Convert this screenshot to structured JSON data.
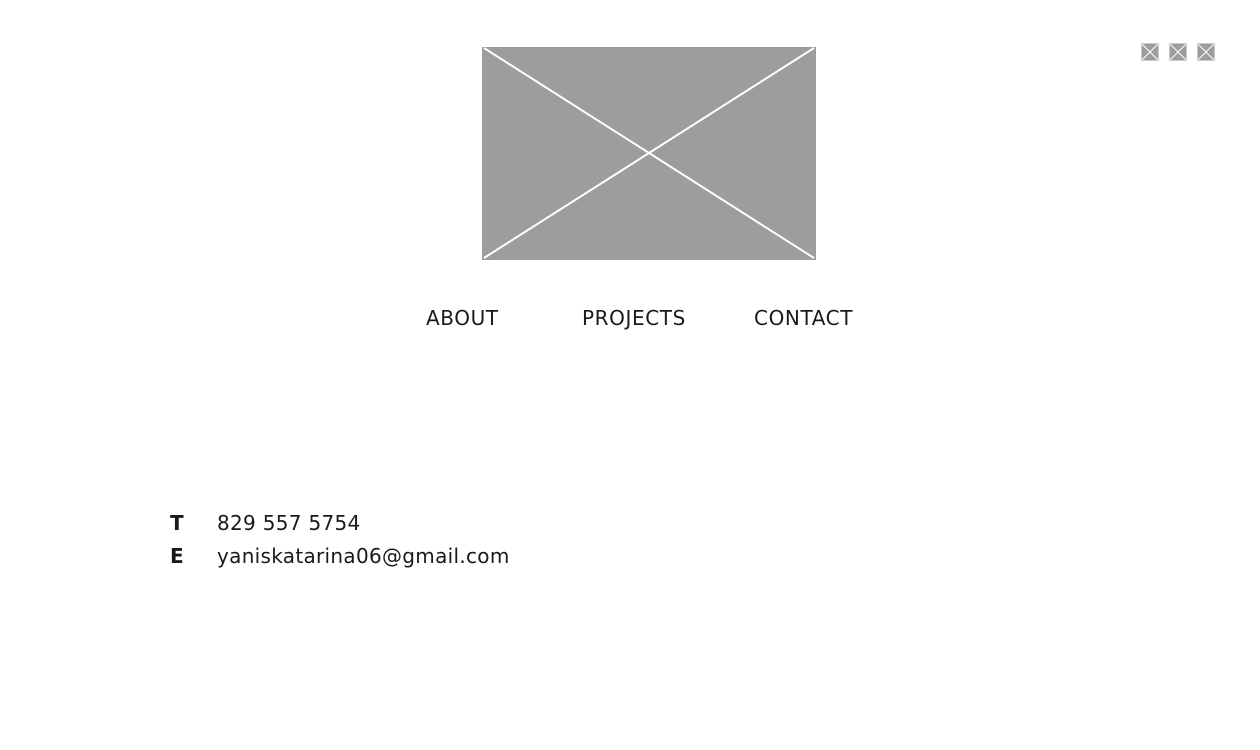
{
  "colors": {
    "placeholder_fill": "#9c9e9d",
    "placeholder_line": "#ffffff",
    "text": "#1a1a1a",
    "background": "#ffffff"
  },
  "header": {
    "logo_icon": "image-placeholder-icon",
    "social_icons": [
      "image-placeholder-icon",
      "image-placeholder-icon",
      "image-placeholder-icon"
    ]
  },
  "nav": {
    "items": [
      {
        "label": "ABOUT"
      },
      {
        "label": "PROJECTS"
      },
      {
        "label": "CONTACT"
      }
    ]
  },
  "contact": {
    "phone_key": "T",
    "phone": "829 557 5754",
    "email_key": "E",
    "email": "yaniskatarina06@gmail.com"
  }
}
